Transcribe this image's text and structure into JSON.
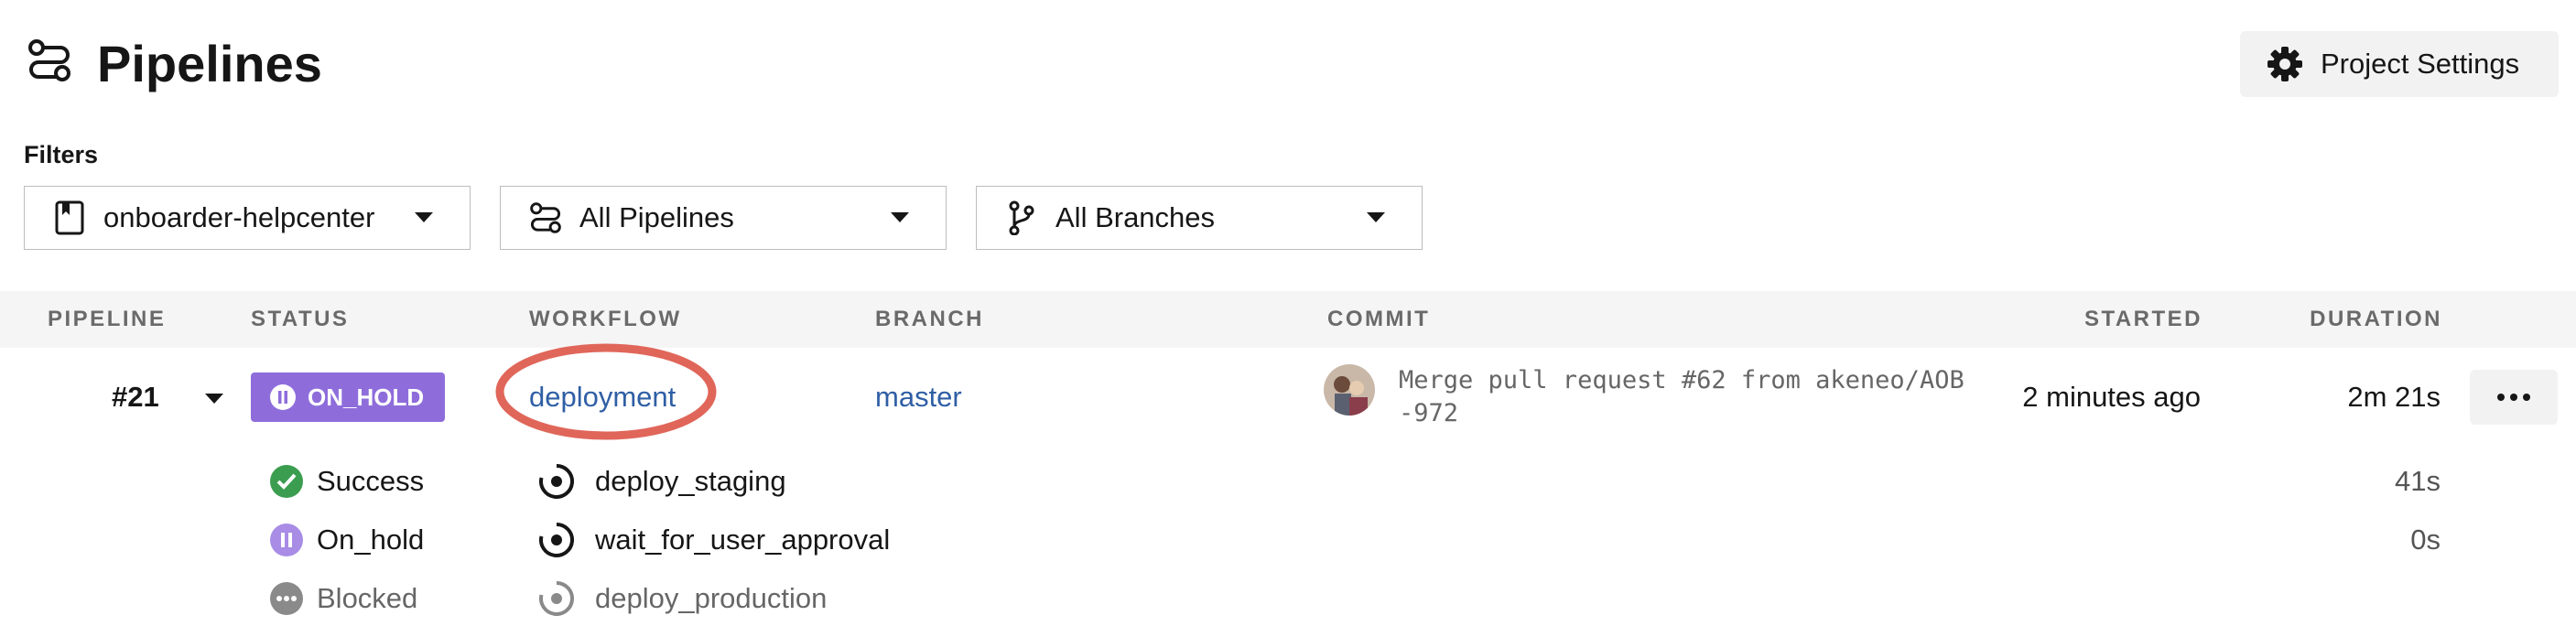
{
  "header": {
    "title": "Pipelines",
    "settings_label": "Project Settings"
  },
  "filters": {
    "label": "Filters",
    "project": "onboarder-helpcenter",
    "pipelines": "All Pipelines",
    "branches": "All Branches"
  },
  "table": {
    "columns": [
      "PIPELINE",
      "STATUS",
      "WORKFLOW",
      "BRANCH",
      "COMMIT",
      "STARTED",
      "DURATION"
    ],
    "rows": [
      {
        "pipeline": "#21",
        "status": "ON_HOLD",
        "workflow": "deployment",
        "branch": "master",
        "commit": "Merge pull request #62 from akeneo/AOB-972",
        "started": "2 minutes ago",
        "duration": "2m 21s",
        "jobs": [
          {
            "status": "Success",
            "name": "deploy_staging",
            "duration": "41s"
          },
          {
            "status": "On_hold",
            "name": "wait_for_user_approval",
            "duration": "0s"
          },
          {
            "status": "Blocked",
            "name": "deploy_production",
            "duration": ""
          }
        ]
      }
    ]
  },
  "colors": {
    "on_hold": "#8e6ddb",
    "success": "#3b9d4f",
    "link": "#2f5fa5",
    "annotation": "#e0665a"
  }
}
